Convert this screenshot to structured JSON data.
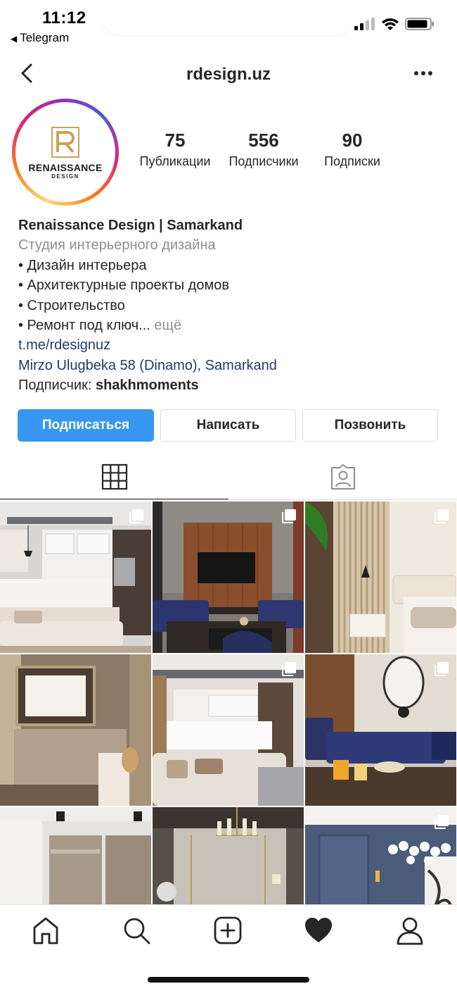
{
  "status_bar": {
    "time": "11:12",
    "back_app": "Telegram",
    "icons": [
      "signal-icon",
      "wifi-icon",
      "battery-icon"
    ]
  },
  "nav": {
    "title": "rdesign.uz",
    "back_icon": "chevron-left-icon",
    "more_icon": "more-horizontal-icon"
  },
  "profile": {
    "avatar_logo_letter": "R",
    "avatar_brand": "RENAISSANCE",
    "avatar_sub": "DESIGN",
    "stats": [
      {
        "value": "75",
        "label": "Публикации"
      },
      {
        "value": "556",
        "label": "Подписчики"
      },
      {
        "value": "90",
        "label": "Подписки"
      }
    ]
  },
  "bio": {
    "name": "Renaissance Design | Samarkand",
    "category": "Студия интерьерного дизайна",
    "lines": [
      "• Дизайн интерьера",
      "• Архитектурные проекты домов",
      "• Строительство",
      "• Ремонт под ключ..."
    ],
    "more": "ещё",
    "link": "t.me/rdesignuz",
    "address": "Mirzo Ulugbeka 58 (Dinamo), Samarkand",
    "followed_by_label": "Подписчик:",
    "followed_by_user": "shakhmoments"
  },
  "actions": {
    "follow": "Подписаться",
    "message": "Написать",
    "call": "Позвонить"
  },
  "tabs": [
    {
      "icon": "grid-icon",
      "active": true
    },
    {
      "icon": "tagged-user-icon",
      "active": false
    }
  ],
  "grid": {
    "tiles": [
      {
        "name": "post-kitchen-living",
        "multi": true
      },
      {
        "name": "post-tv-living-room",
        "multi": true
      },
      {
        "name": "post-bedroom-slats",
        "multi": true
      },
      {
        "name": "post-bedroom-mirror",
        "multi": false
      },
      {
        "name": "post-kitchen-sofa",
        "multi": true
      },
      {
        "name": "post-dining-blue",
        "multi": true
      },
      {
        "name": "post-wardrobe-room",
        "multi": false
      },
      {
        "name": "post-chandelier-room",
        "multi": false
      },
      {
        "name": "post-blue-wall-room",
        "multi": true
      }
    ]
  },
  "bottom_nav": [
    "home-icon",
    "search-icon",
    "new-post-icon",
    "activity-heart-icon",
    "profile-icon"
  ]
}
